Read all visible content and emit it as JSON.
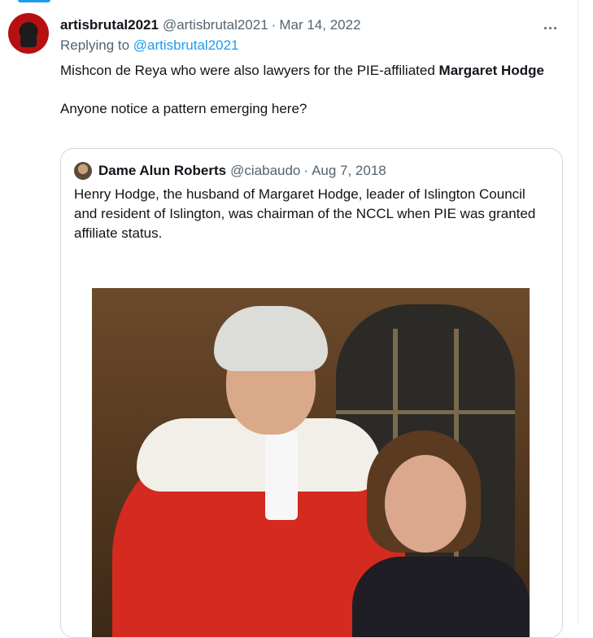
{
  "tweet": {
    "author_name": "artisbrutal2021",
    "handle": "@artisbrutal2021",
    "separator": "·",
    "date": "Mar 14, 2022",
    "more_icon": "...",
    "replying_prefix": "Replying to",
    "replying_handle": "@artisbrutal2021",
    "text_part1": "Mishcon de Reya who were also lawyers for the PIE-affiliated ",
    "text_bold": "Margaret Hodge",
    "text_part2": "Anyone notice a pattern emerging here?"
  },
  "quoted_tweet": {
    "author_name": "Dame Alun Roberts",
    "handle": "@ciabaudo",
    "separator": "·",
    "date": "Aug 7, 2018",
    "text": "Henry Hodge, the husband of Margaret Hodge, leader of Islington Council and resident of Islington, was chairman of the NCCL when PIE was granted affiliate status."
  },
  "colors": {
    "accent": "#1d9bf0",
    "muted_text": "#536471",
    "primary_text": "#0f1419",
    "border": "#cfd9de"
  }
}
